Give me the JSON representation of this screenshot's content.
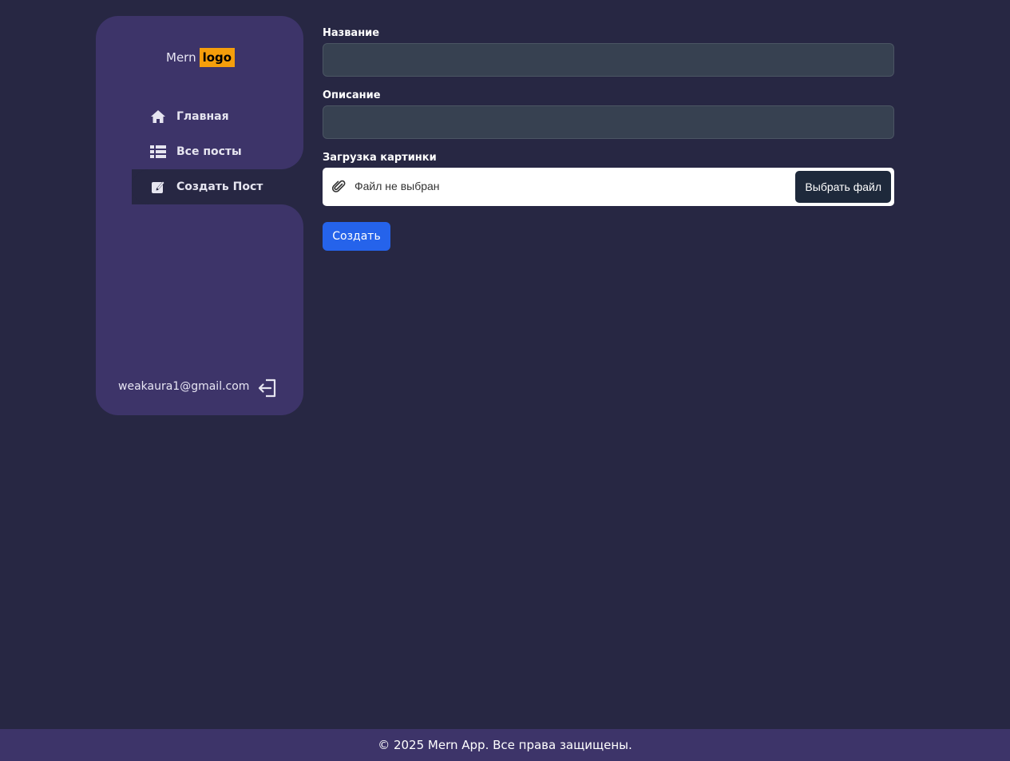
{
  "sidebar": {
    "logo": {
      "text": "Mern",
      "highlight": "logo"
    },
    "nav": [
      {
        "label": "Главная",
        "icon": "home-icon"
      },
      {
        "label": "Все посты",
        "icon": "list-icon"
      },
      {
        "label": "Создать Пост",
        "icon": "edit-icon",
        "active": true
      }
    ],
    "user_email": "weakaura1@gmail.com",
    "logout_icon": "logout-icon"
  },
  "form": {
    "title_label": "Название",
    "title_value": "",
    "description_label": "Описание",
    "description_value": "",
    "image_label": "Загрузка картинки",
    "file_status": "Файл не выбран",
    "file_button": "Выбрать файл",
    "submit_label": "Создать"
  },
  "footer": {
    "text": "© 2025 Mern App. Все права защищены."
  },
  "colors": {
    "background": "#272743",
    "sidebar": "#3d3469",
    "logo_accent": "#f59e0b",
    "input_bg": "#374151",
    "primary_button": "#2563eb",
    "file_button": "#1e293b"
  }
}
